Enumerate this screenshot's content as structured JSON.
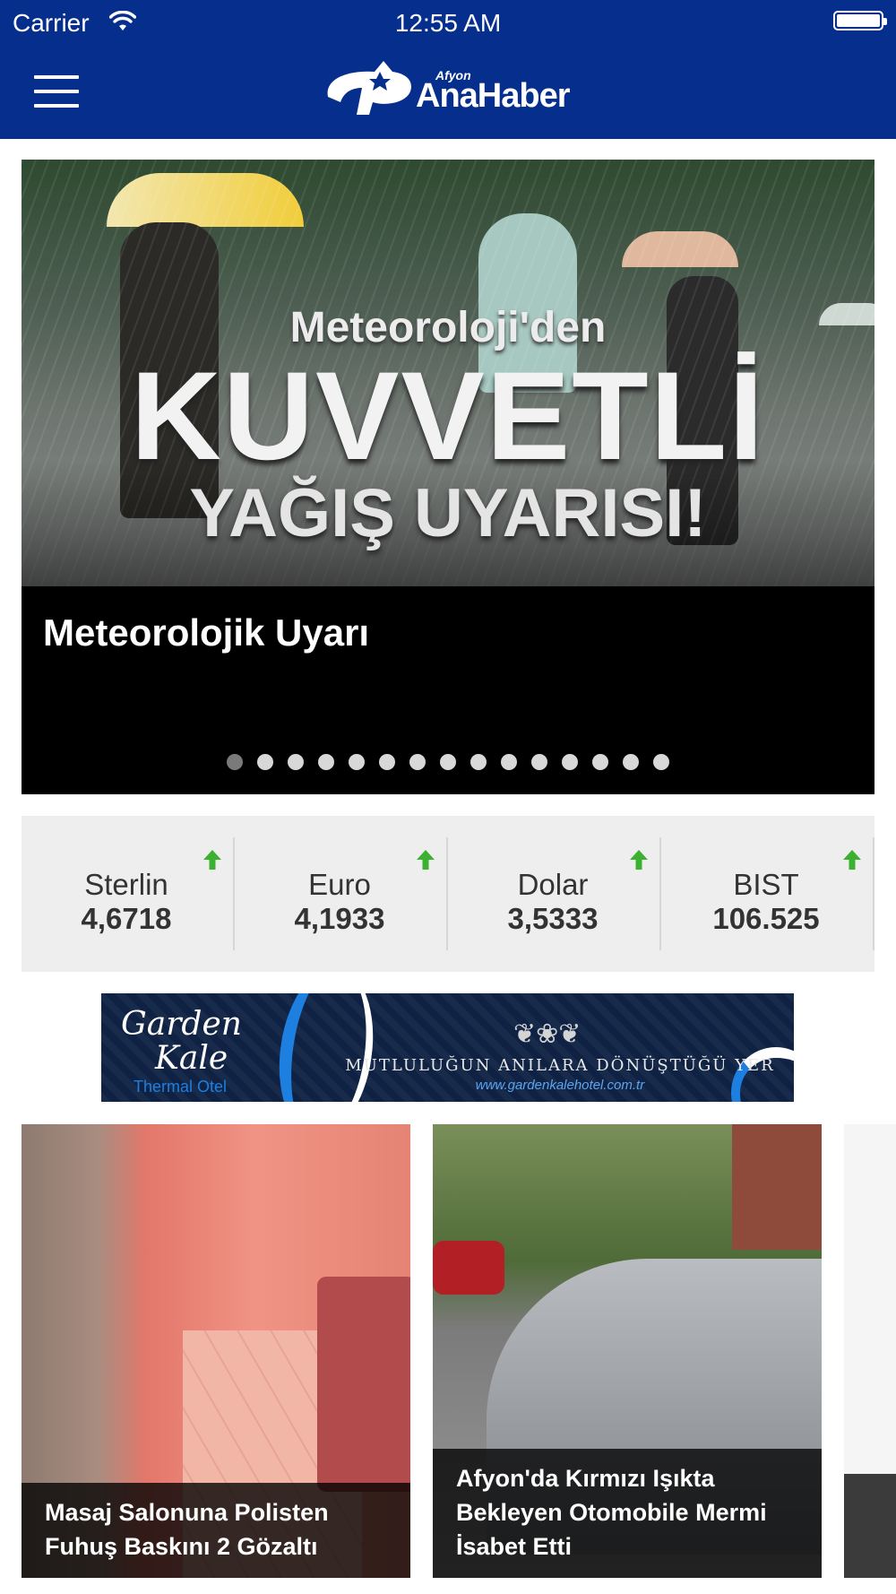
{
  "status_bar": {
    "carrier": "Carrier",
    "time": "12:55 AM"
  },
  "header": {
    "brand_small": "Afyon",
    "brand_name": "AnaHaber",
    "colors": {
      "nav_bg": "#062f8d"
    }
  },
  "featured": {
    "image_text_1": "Meteoroloji'den",
    "image_text_2": "KUVVETLİ",
    "image_text_3": "YAĞIŞ UYARISI!",
    "title": "Meteorolojik Uyarı",
    "slide_count": 15,
    "active_slide": 1
  },
  "currencies": [
    {
      "name": "Sterlin",
      "value": "4,6718",
      "trend": "up"
    },
    {
      "name": "Euro",
      "value": "4,1933",
      "trend": "up"
    },
    {
      "name": "Dolar",
      "value": "3,5333",
      "trend": "up"
    },
    {
      "name": "BIST",
      "value": "106.525",
      "trend": "up"
    }
  ],
  "trend_up_color": "#3cb030",
  "ad": {
    "brand_line1": "Garden",
    "brand_line2": "Kale",
    "brand_line3": "Thermal Otel",
    "slogan": "MUTLULUĞUN ANILARA DÖNÜŞTÜĞÜ YER",
    "url": "www.gardenkalehotel.com.tr"
  },
  "news": [
    {
      "title": "Masaj Salonuna Polisten Fuhuş Baskını 2 Gözaltı"
    },
    {
      "title": "Afyon'da Kırmızı Işıkta Bekleyen Otomobile Mermi İsabet Etti"
    }
  ],
  "icons": {
    "menu": "hamburger-menu-icon",
    "wifi": "wifi-icon",
    "battery": "battery-icon",
    "trend_up": "arrow-up-icon"
  }
}
